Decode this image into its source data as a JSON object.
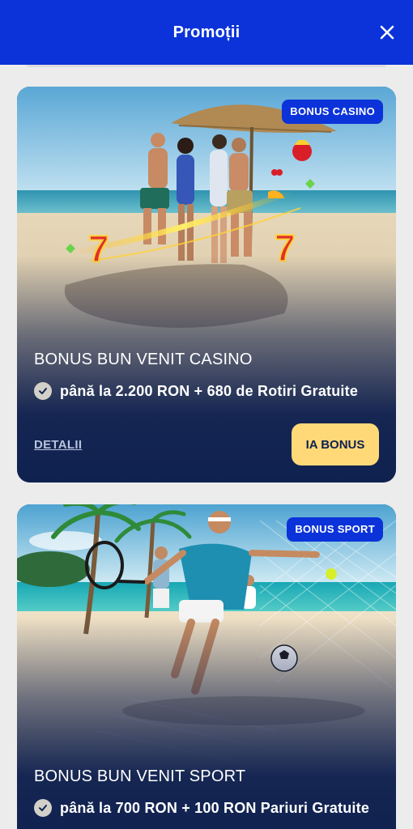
{
  "header": {
    "title": "Promoții"
  },
  "promotions": [
    {
      "badge": "BONUS CASINO",
      "title": "BONUS BUN VENIT CASINO",
      "subtitle": "până la 2.200 RON + 680 de Rotiri Gratuite",
      "details_label": "DETALII",
      "cta_label": "IA BONUS"
    },
    {
      "badge": "BONUS SPORT",
      "title": "BONUS BUN VENIT SPORT",
      "subtitle": "până la 700 RON + 100 RON Pariuri Gratuite"
    }
  ],
  "colors": {
    "header_bg": "#0b33d9",
    "card_bg": "#0f2150",
    "cta_bg": "#ffd978",
    "badge_bg": "#0b33d9"
  },
  "icons": [
    "close-icon",
    "check-icon"
  ]
}
